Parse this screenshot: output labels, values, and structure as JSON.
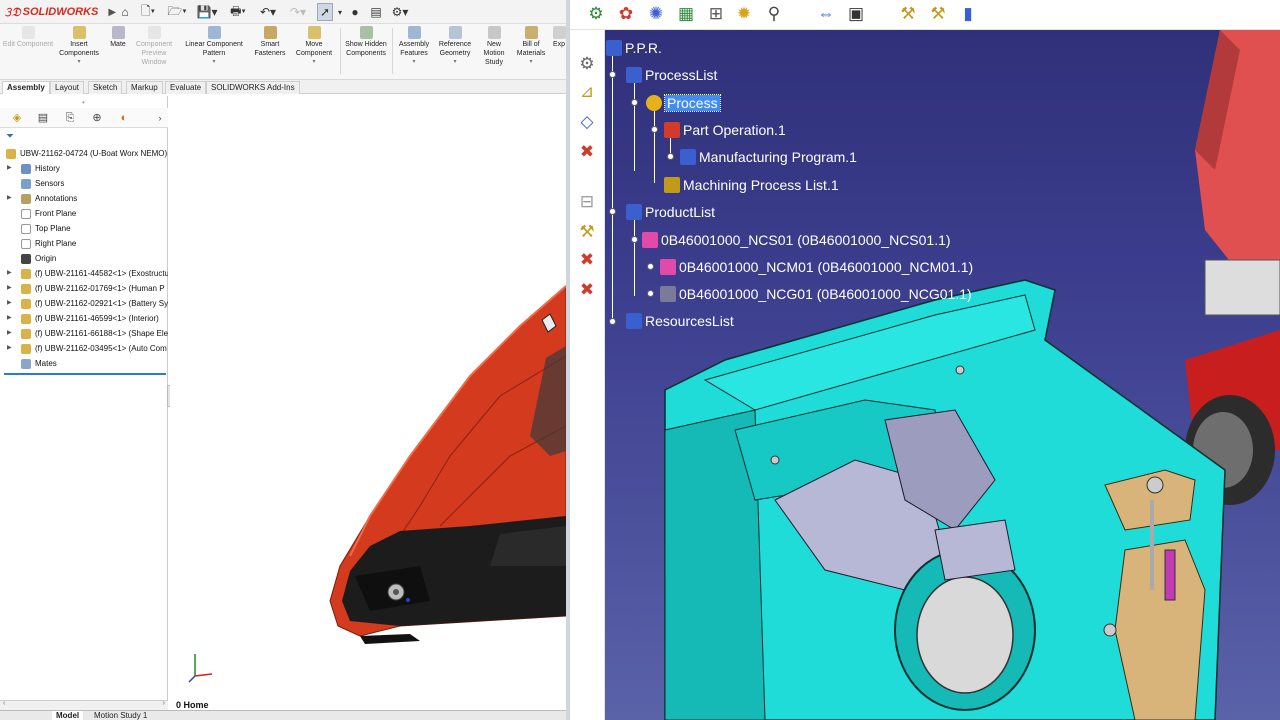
{
  "solidworks": {
    "app_name": "SOLIDWORKS",
    "ribbon": [
      {
        "label": "Edit Component",
        "enabled": false
      },
      {
        "label": "Insert Components",
        "enabled": true
      },
      {
        "label": "Mate",
        "enabled": true
      },
      {
        "label": "Component Preview Window",
        "enabled": false
      },
      {
        "label": "Linear Component Pattern",
        "enabled": true
      },
      {
        "label": "Smart Fasteners",
        "enabled": true
      },
      {
        "label": "Move Component",
        "enabled": true
      },
      {
        "label": "Show Hidden Components",
        "enabled": true
      },
      {
        "label": "Assembly Features",
        "enabled": true
      },
      {
        "label": "Reference Geometry",
        "enabled": true
      },
      {
        "label": "New Motion Study",
        "enabled": true
      },
      {
        "label": "Bill of Materials",
        "enabled": true
      },
      {
        "label": "Exp",
        "enabled": true
      }
    ],
    "tabs": [
      "Assembly",
      "Layout",
      "Sketch",
      "Markup",
      "Evaluate",
      "SOLIDWORKS Add-Ins"
    ],
    "active_tab": "Assembly",
    "tree": {
      "root": "UBW-21162-04724 (U-Boat Worx NEMO)",
      "items": [
        {
          "label": "History",
          "expandable": true
        },
        {
          "label": "Sensors",
          "expandable": false
        },
        {
          "label": "Annotations",
          "expandable": true
        },
        {
          "label": "Front Plane",
          "expandable": false
        },
        {
          "label": "Top Plane",
          "expandable": false
        },
        {
          "label": "Right Plane",
          "expandable": false
        },
        {
          "label": "Origin",
          "expandable": false
        },
        {
          "label": "(f) UBW-21161-44582<1> (Exostructu",
          "expandable": true
        },
        {
          "label": "(f) UBW-21162-01769<1> (Human P",
          "expandable": true
        },
        {
          "label": "(f) UBW-21162-02921<1> (Battery Sy",
          "expandable": true
        },
        {
          "label": "(f) UBW-21161-46599<1> (Interior)",
          "expandable": true
        },
        {
          "label": "(f) UBW-21161-66188<1> (Shape Ele",
          "expandable": true
        },
        {
          "label": "(f) UBW-21162-03495<1> (Auto Com",
          "expandable": true
        },
        {
          "label": "Mates",
          "expandable": false
        }
      ]
    },
    "view_label": "0 Home",
    "bottom_tabs": [
      "",
      "Model",
      "Motion Study 1"
    ],
    "active_bottom_tab": "Model"
  },
  "catia": {
    "tree": {
      "root": "P.P.R.",
      "process_list": "ProcessList",
      "process": "Process",
      "part_operation": "Part Operation.1",
      "manufacturing_program": "Manufacturing Program.1",
      "machining_process_list": "Machining Process List.1",
      "product_list": "ProductList",
      "products": [
        "0B46001000_NCS01 (0B46001000_NCS01.1)",
        "0B46001000_NCM01 (0B46001000_NCM01.1)",
        "0B46001000_NCG01 (0B46001000_NCG01.1)"
      ],
      "resources_list": "ResourcesList"
    }
  }
}
